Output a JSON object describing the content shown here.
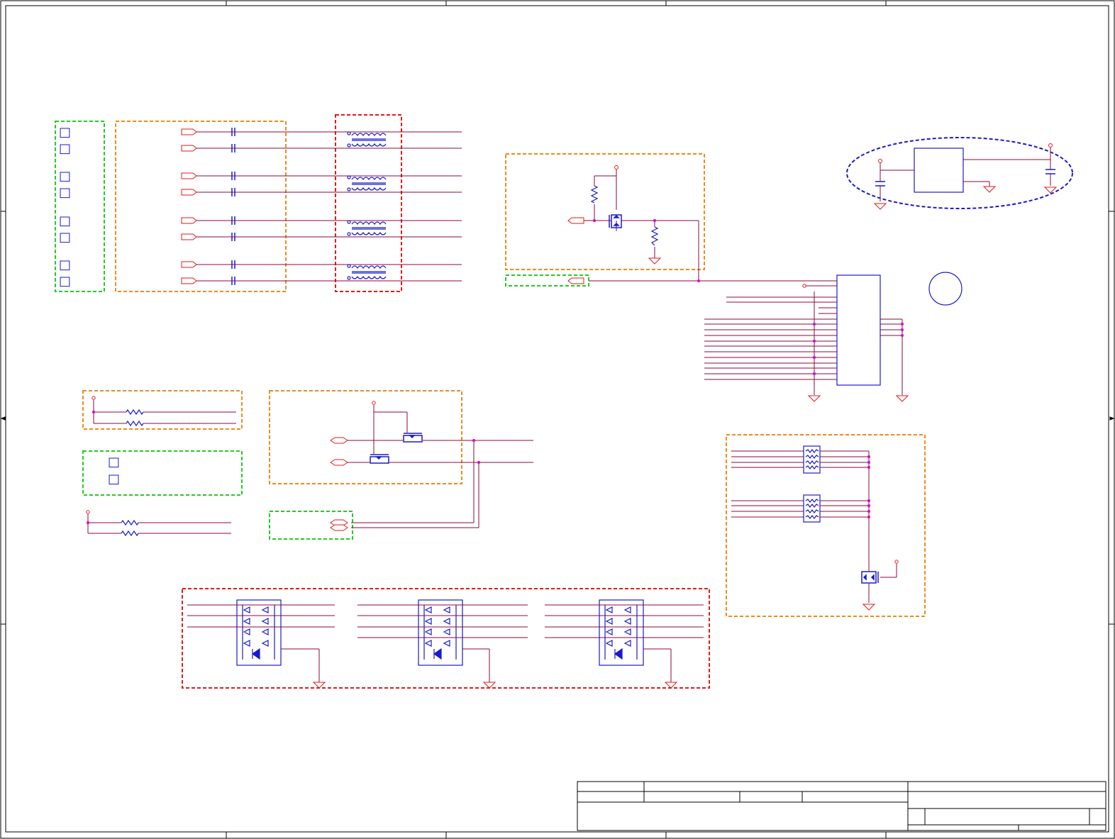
{
  "sheet": {
    "paper_color": "#ffffff",
    "frame_color": "#000000",
    "wire_color": "#8b0a3c",
    "component_color": "#1a1acc",
    "port_color": "#e21b1b",
    "junction_color": "#d400d4"
  },
  "groups": [
    {
      "name": "status-label-block",
      "border": "green"
    },
    {
      "name": "ac-coupling-capacitors",
      "border": "orange"
    },
    {
      "name": "ethernet-transformers",
      "border": "red"
    },
    {
      "name": "mosfet-switch-circuit",
      "border": "orange"
    },
    {
      "name": "ldo-regulator",
      "border": "blue"
    },
    {
      "name": "resistor-network-pair",
      "border": "orange"
    },
    {
      "name": "level-shifter",
      "border": "orange"
    },
    {
      "name": "resistor-arrays",
      "border": "orange"
    },
    {
      "name": "tvs-diode-arrays",
      "border": "red"
    }
  ],
  "labels": {
    "cjk_glyph": "□"
  },
  "title_block": {
    "title": "",
    "sheet_number": "",
    "revision": ""
  }
}
